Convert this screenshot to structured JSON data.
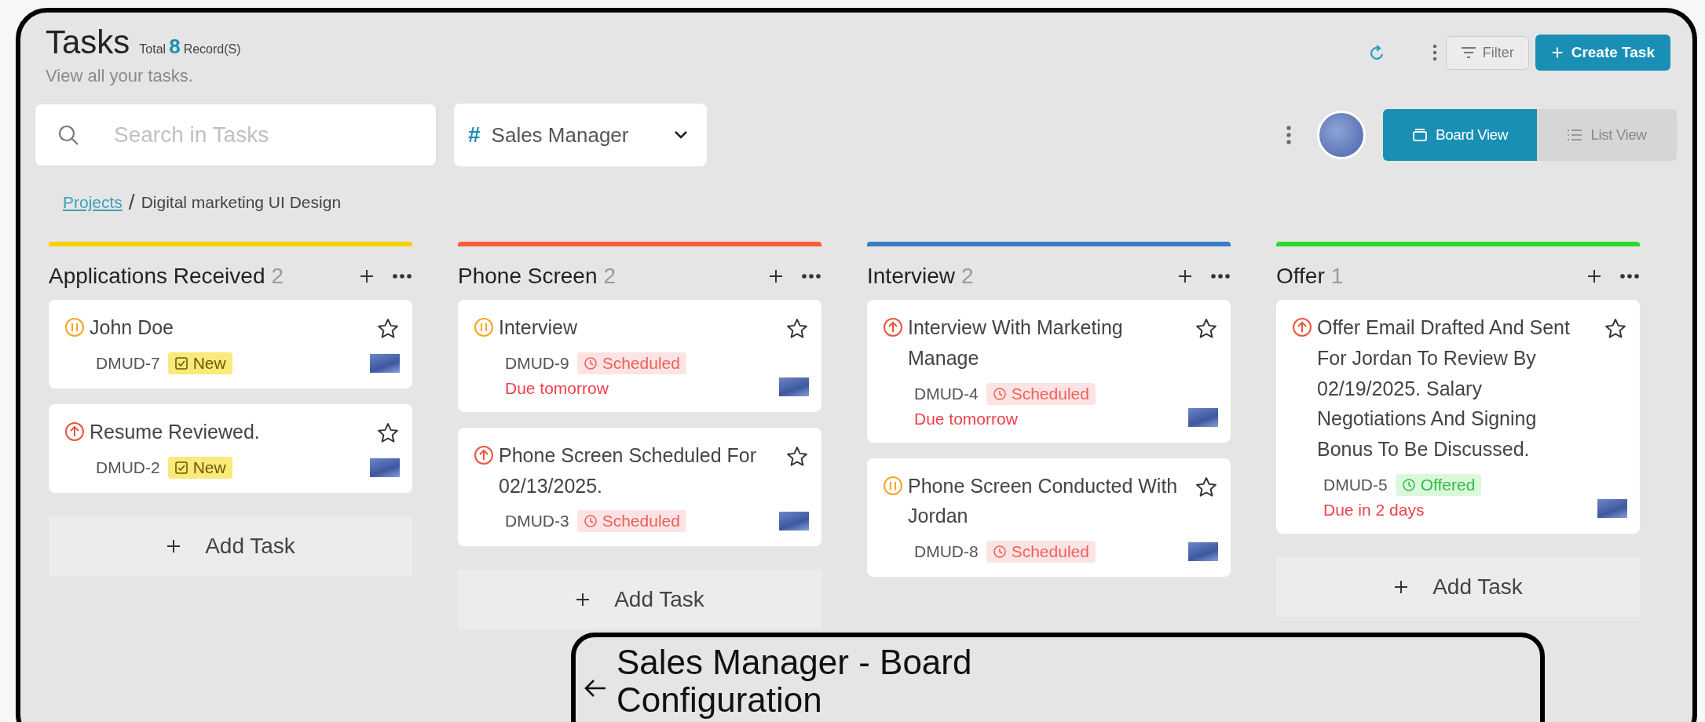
{
  "header": {
    "title": "Tasks",
    "total_label": "Total",
    "total_count": "8",
    "records_label": "Record(S)",
    "subtitle": "View all your tasks."
  },
  "toolbar": {
    "filter_label": "Filter",
    "create_label": "Create Task"
  },
  "search": {
    "placeholder": "Search in Tasks"
  },
  "role_select": {
    "prefix": "#",
    "value": "Sales Manager"
  },
  "views": [
    {
      "label": "Board View",
      "kind": "board",
      "selected": true
    },
    {
      "label": "List View",
      "kind": "list",
      "selected": false
    }
  ],
  "breadcrumb": {
    "link": "Projects",
    "separator": "/",
    "current": "Digital marketing UI Design"
  },
  "columns": [
    {
      "title": "Applications Received",
      "count": "2",
      "color": "#f8d000",
      "add_task": "Add Task",
      "cards": [
        {
          "title": "John Doe",
          "kind": "pause",
          "starred": false,
          "id": "DMUD-7",
          "status": {
            "label": "New",
            "kind": "new"
          }
        },
        {
          "title": "Resume Reviewed.",
          "kind": "up",
          "starred": false,
          "id": "DMUD-2",
          "status": {
            "label": "New",
            "kind": "new"
          }
        }
      ]
    },
    {
      "title": "Phone Screen",
      "count": "2",
      "color": "#ff5a3c",
      "add_task": "Add Task",
      "cards": [
        {
          "title": "Interview",
          "kind": "pause",
          "starred": false,
          "id": "DMUD-9",
          "status": {
            "label": "Scheduled",
            "kind": "scheduled"
          },
          "due": "Due tomorrow"
        },
        {
          "title": "Phone Screen Scheduled For 02/13/2025.",
          "kind": "up",
          "starred": false,
          "id": "DMUD-3",
          "status": {
            "label": "Scheduled",
            "kind": "scheduled"
          }
        }
      ]
    },
    {
      "title": "Interview",
      "count": "2",
      "color": "#3a7cc2",
      "cards": [
        {
          "title": "Interview With Marketing Manage",
          "kind": "up",
          "starred": false,
          "id": "DMUD-4",
          "status": {
            "label": "Scheduled",
            "kind": "scheduled"
          },
          "due": "Due tomorrow"
        },
        {
          "title": "Phone Screen Conducted With Jordan",
          "kind": "pause",
          "starred": false,
          "id": "DMUD-8",
          "status": {
            "label": "Scheduled",
            "kind": "scheduled"
          }
        }
      ]
    },
    {
      "title": "Offer",
      "count": "1",
      "color": "#2ed62e",
      "add_task": "Add Task",
      "cards": [
        {
          "title": "Offer Email Drafted And Sent For Jordan To Review By 02/19/2025. Salary Negotiations And Signing Bonus To Be Discussed.",
          "kind": "up",
          "starred": false,
          "id": "DMUD-5",
          "status": {
            "label": "Offered",
            "kind": "offered"
          },
          "due": "Due in 2 days"
        }
      ]
    }
  ],
  "dialog": {
    "title": "Sales Manager - Board Configuration"
  }
}
